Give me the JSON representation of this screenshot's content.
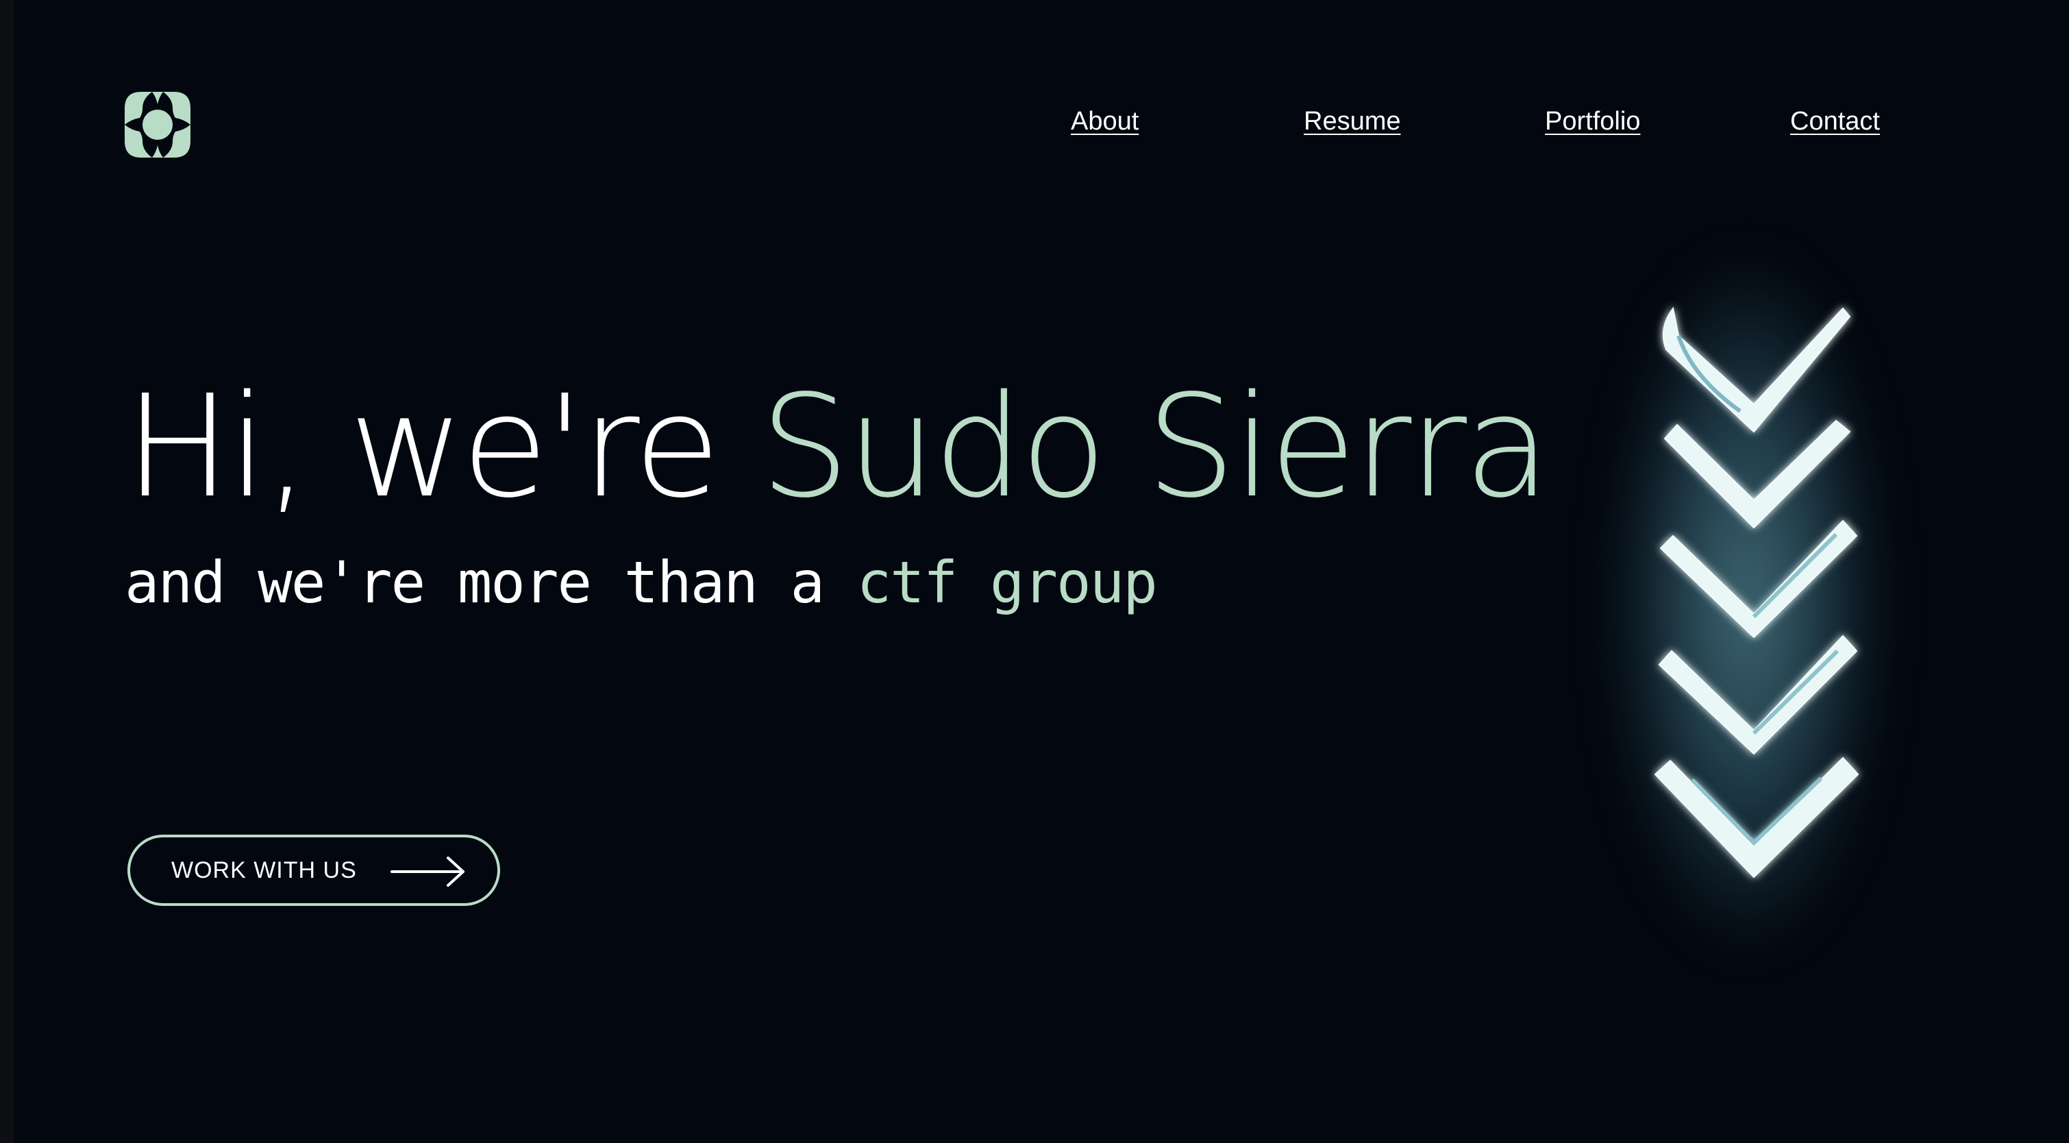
{
  "brand": {
    "logo_icon": "flower-quad-logo",
    "accent_color": "#b9dcc6",
    "background_color": "#030810"
  },
  "nav": {
    "items": [
      {
        "label": "About"
      },
      {
        "label": "Resume"
      },
      {
        "label": "Portfolio"
      },
      {
        "label": "Contact"
      }
    ]
  },
  "hero": {
    "title_prefix": "Hi, we're",
    "title_accent": "Sudo Sierra",
    "subtitle_prefix": "and we're more than a",
    "subtitle_accent": "ctf group"
  },
  "cta": {
    "label": "WORK WITH US",
    "icon": "arrow-right-icon"
  },
  "art": {
    "icon": "neon-chevrons-down-icon"
  }
}
